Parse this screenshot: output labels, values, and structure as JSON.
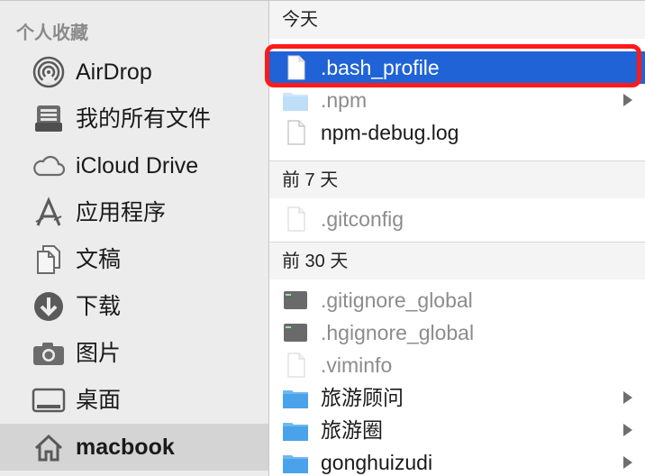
{
  "sidebar": {
    "header": "个人收藏",
    "items": [
      {
        "label": "AirDrop",
        "icon": "airdrop-icon"
      },
      {
        "label": "我的所有文件",
        "icon": "all-files-icon"
      },
      {
        "label": "iCloud Drive",
        "icon": "cloud-icon"
      },
      {
        "label": "应用程序",
        "icon": "applications-icon"
      },
      {
        "label": "文稿",
        "icon": "documents-icon"
      },
      {
        "label": "下载",
        "icon": "download-icon"
      },
      {
        "label": "图片",
        "icon": "camera-icon"
      },
      {
        "label": "桌面",
        "icon": "desktop-icon"
      },
      {
        "label": "macbook",
        "icon": "home-icon"
      }
    ]
  },
  "sections": [
    {
      "header": "今天",
      "files": [
        {
          "name": ".bash_profile",
          "icon": "file-icon"
        },
        {
          "name": ".npm",
          "icon": "folder-icon"
        },
        {
          "name": "npm-debug.log",
          "icon": "file-icon"
        }
      ]
    },
    {
      "header": "前 7 天",
      "files": [
        {
          "name": ".gitconfig",
          "icon": "file-icon"
        }
      ]
    },
    {
      "header": "前 30 天",
      "files": [
        {
          "name": ".gitignore_global",
          "icon": "terminal-file-icon"
        },
        {
          "name": ".hgignore_global",
          "icon": "terminal-file-icon"
        },
        {
          "name": ".viminfo",
          "icon": "file-icon"
        },
        {
          "name": "旅游顾问",
          "icon": "folder-icon"
        },
        {
          "name": "旅游圈",
          "icon": "folder-icon"
        },
        {
          "name": "gonghuizudi",
          "icon": "folder-icon"
        }
      ]
    }
  ],
  "colors": {
    "selection": "#1f63d6",
    "highlight": "#ff1a1a",
    "folder": "#a8d3f5"
  }
}
